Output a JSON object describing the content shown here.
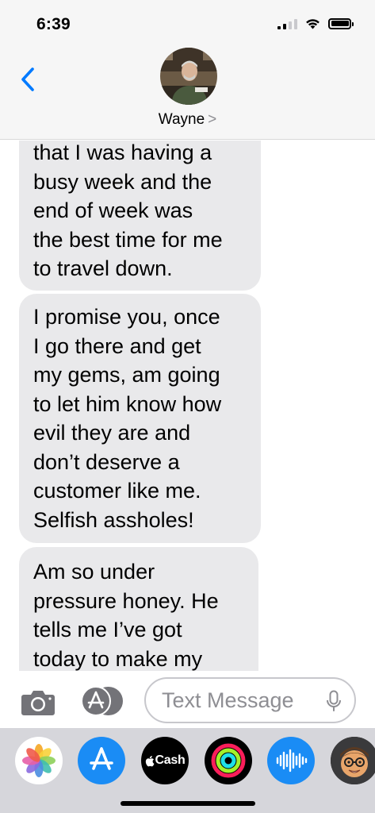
{
  "status_bar": {
    "time": "6:39"
  },
  "header": {
    "contact_name": "Wayne",
    "chevron": ">"
  },
  "messages": [
    {
      "text": "that I was having a\nbusy week and the\nend of week was\nthe best time for me\nto travel down."
    },
    {
      "text": "I promise you, once\nI go there and get\nmy gems, am going\nto let him know how\nevil they are and\ndon’t deserve a\ncustomer like me.\nSelfish assholes!"
    },
    {
      "text": "Am so under\npressure honey. He\ntells me I’ve got\ntoday to make my"
    }
  ],
  "input_bar": {
    "placeholder": "Text Message"
  },
  "app_drawer": {
    "cash_label": "Cash"
  },
  "colors": {
    "accent": "#007aff",
    "bubble_received": "#e9e9eb",
    "header_bg": "#f6f6f6",
    "drawer_bg": "#d6d6db"
  }
}
